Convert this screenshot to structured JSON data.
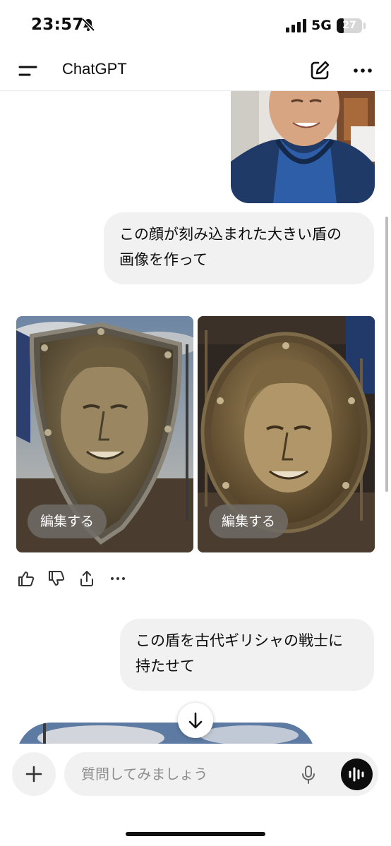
{
  "status_bar": {
    "time": "23:57",
    "network": "5G",
    "battery": "27",
    "battery_level": 0.27
  },
  "header": {
    "title": "ChatGPT"
  },
  "messages": {
    "user_prompt_1": "この顔が刻み込まれた大きい盾の画像を作って",
    "user_prompt_1_lines": [
      "この顔が刻み込まれた大きい盾の",
      "画像を作って"
    ],
    "edit_label": "編集する",
    "user_prompt_2_lines": [
      "この盾を古代ギリシャの戦士に",
      "持たせて"
    ]
  },
  "composer": {
    "placeholder": "質問してみましょう"
  },
  "colors": {
    "bubble": "#f1f1f1",
    "text": "#0d0d0d",
    "accent": "#0d0d0d"
  }
}
